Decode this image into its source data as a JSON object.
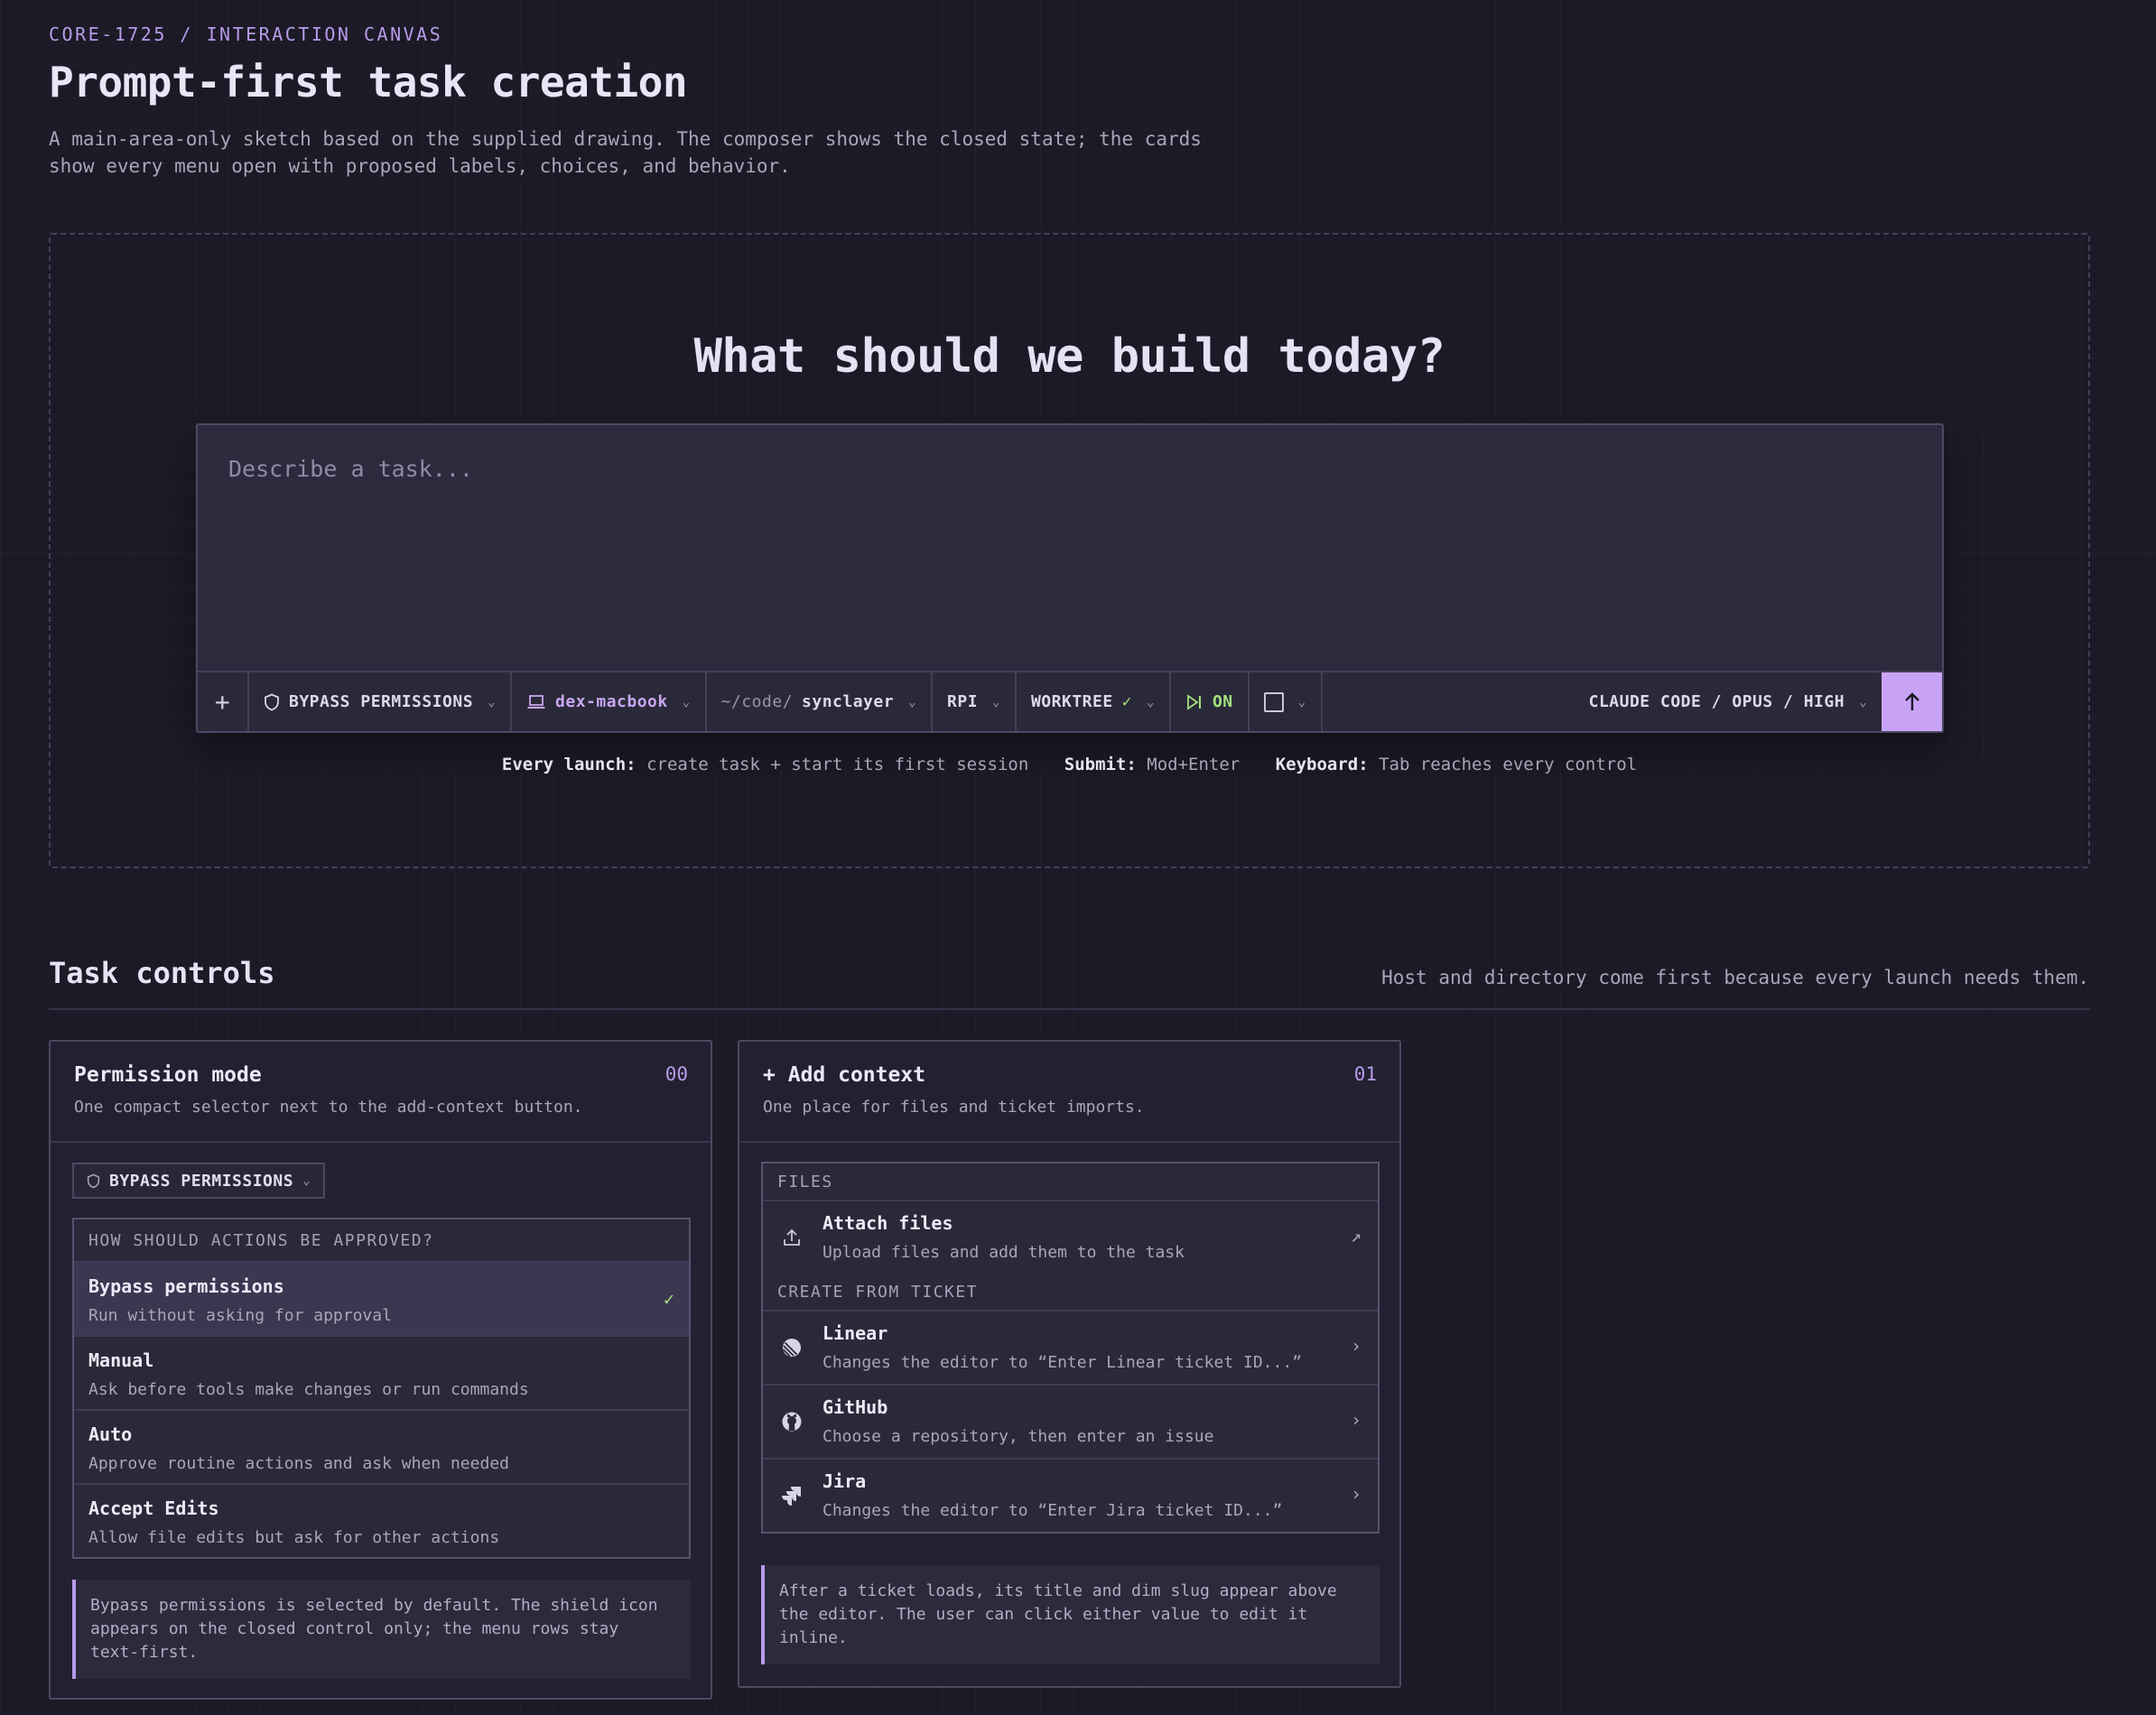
{
  "header": {
    "eyebrow": "CORE-1725 / INTERACTION CANVAS",
    "title": "Prompt-first task creation",
    "description": "A main-area-only sketch based on the supplied drawing. The composer shows the closed state; the cards show every menu open with proposed labels, choices, and behavior."
  },
  "canvas": {
    "hero": "What should we build today?",
    "composer": {
      "placeholder": "Describe a task...",
      "add_label": "+",
      "permissions_label": "BYPASS PERMISSIONS",
      "host_label": "dex-macbook",
      "dir_prefix": "~/code/",
      "dir_name": "synclayer",
      "workflow_label": "RPI",
      "worktree_label": "WORKTREE",
      "worktree_check": "✓",
      "autorun_label": "ON",
      "model_label": "CLAUDE CODE / OPUS / HIGH"
    },
    "hints": [
      {
        "key": "Every launch:",
        "value": "create task + start its first session"
      },
      {
        "key": "Submit:",
        "value": "Mod+Enter"
      },
      {
        "key": "Keyboard:",
        "value": "Tab reaches every control"
      }
    ]
  },
  "section": {
    "title": "Task controls",
    "note": "Host and directory come first because every launch needs them."
  },
  "cards": {
    "permission": {
      "title": "Permission mode",
      "number": "00",
      "subtitle": "One compact selector next to the add-context button.",
      "pill_label": "BYPASS PERMISSIONS",
      "menu_heading": "HOW SHOULD ACTIONS BE APPROVED?",
      "options": [
        {
          "title": "Bypass permissions",
          "desc": "Run without asking for approval",
          "mark": "✓"
        },
        {
          "title": "Manual",
          "desc": "Ask before tools make changes or run commands"
        },
        {
          "title": "Auto",
          "desc": "Approve routine actions and ask when needed"
        },
        {
          "title": "Accept Edits",
          "desc": "Allow file edits but ask for other actions"
        }
      ],
      "note": "Bypass permissions is selected by default. The shield icon appears on the closed control only; the menu rows stay text-first."
    },
    "context": {
      "title": "Add context",
      "title_prefix": "+",
      "number": "01",
      "subtitle": "One place for files and ticket imports.",
      "files_heading": "FILES",
      "attach": {
        "title": "Attach files",
        "desc": "Upload files and add them to the task",
        "go": "↗"
      },
      "ticket_heading": "CREATE FROM TICKET",
      "tickets": [
        {
          "title": "Linear",
          "desc": "Changes the editor to “Enter Linear ticket ID...”",
          "go": "›",
          "icon": "linear-icon"
        },
        {
          "title": "GitHub",
          "desc": "Choose a repository, then enter an issue",
          "go": "›",
          "icon": "github-icon"
        },
        {
          "title": "Jira",
          "desc": "Changes the editor to “Enter Jira ticket ID...”",
          "go": "›",
          "icon": "jira-icon"
        }
      ],
      "note": "After a ticket loads, its title and dim slug appear above the editor. The user can click either value to edit it inline."
    }
  },
  "colors": {
    "background": "#1b1a26",
    "accent": "#c9a3f5",
    "success": "#a5e07e"
  }
}
